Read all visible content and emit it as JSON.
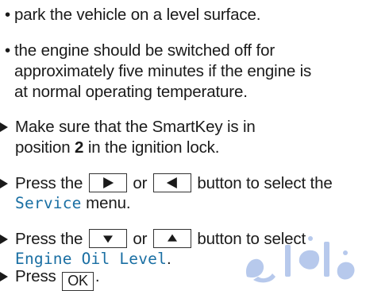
{
  "bullets": [
    {
      "lines": [
        "park the vehicle on a level surface."
      ]
    },
    {
      "lines": [
        "the engine should be switched off for",
        "approximately five minutes if the engine is",
        "at normal operating temperature."
      ]
    }
  ],
  "step1": {
    "line1": "Make sure that the SmartKey is in",
    "line2_pre": "position ",
    "line2_bold": "2",
    "line2_post": " in the ignition lock."
  },
  "step2": {
    "pre": "Press the",
    "or": "or",
    "post": "button to select the",
    "menu": "Service",
    "menu_post": " menu.",
    "key_a_icon": "right-arrow-icon",
    "key_b_icon": "left-arrow-icon"
  },
  "step3": {
    "pre": "Press the",
    "or": "or",
    "post": "button to select",
    "item": "Engine Oil Level",
    "item_post": ".",
    "key_a_icon": "down-arrow-icon",
    "key_b_icon": "up-arrow-icon"
  },
  "step4": {
    "pre": "Press",
    "key": "OK",
    "post": "."
  },
  "colors": {
    "text": "#1a1a1a",
    "display_text": "#1a6fa3",
    "watermark": "#9fb8e6"
  }
}
